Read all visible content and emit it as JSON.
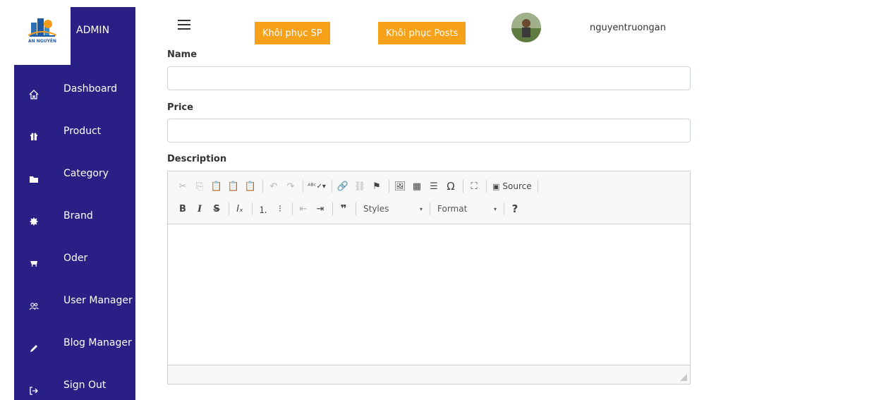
{
  "sidebar": {
    "logo_text": "AN NGUYÊN",
    "title": "ADMIN",
    "items": [
      {
        "label": "Dashboard",
        "icon": "home-icon"
      },
      {
        "label": "Product",
        "icon": "gift-icon"
      },
      {
        "label": "Category",
        "icon": "folder-icon"
      },
      {
        "label": "Brand",
        "icon": "certificate-icon"
      },
      {
        "label": "Oder",
        "icon": "cart-icon"
      },
      {
        "label": "User Manager",
        "icon": "users-icon"
      },
      {
        "label": "Blog Manager",
        "icon": "pencil-icon"
      },
      {
        "label": "Sign Out",
        "icon": "sign-out-icon"
      }
    ]
  },
  "topbar": {
    "restore_products_label": "Khôi phục SP",
    "restore_posts_label": "Khôi phục Posts",
    "username": "nguyentruongan"
  },
  "form": {
    "name_label": "Name",
    "name_value": "",
    "price_label": "Price",
    "price_value": "",
    "description_label": "Description"
  },
  "editor": {
    "source_label": "Source",
    "styles_label": "Styles",
    "format_label": "Format"
  },
  "colors": {
    "sidebar_bg": "#2a1f84",
    "accent_orange": "#f7a01a"
  }
}
